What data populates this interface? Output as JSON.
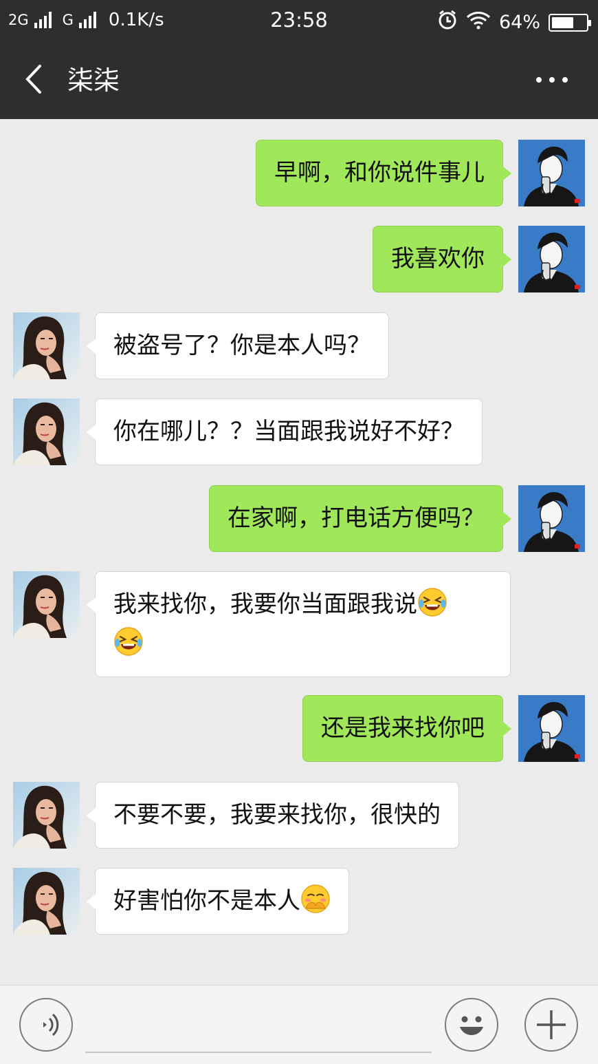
{
  "status_bar": {
    "network1": "2G",
    "network2": "G",
    "speed": "0.1K/s",
    "time": "23:58",
    "battery": "64%",
    "battery_level": 0.64,
    "icons": [
      "alarm-icon",
      "wifi-icon",
      "battery-icon"
    ]
  },
  "nav": {
    "title": "柒柒",
    "back_icon": "chevron-left-icon",
    "more_icon": "more-dots-icon"
  },
  "messages": [
    {
      "from": "me",
      "text": "早啊，和你说件事儿"
    },
    {
      "from": "me",
      "text": "我喜欢你"
    },
    {
      "from": "them",
      "text": "被盗号了？你是本人吗？"
    },
    {
      "from": "them",
      "text": "你在哪儿？？当面跟我说好不好？"
    },
    {
      "from": "me",
      "text": "在家啊，打电话方便吗？"
    },
    {
      "from": "them",
      "text": "我来找你，我要你当面跟我说",
      "emoji": [
        "laughing-tears-emoji",
        "laughing-tears-emoji"
      ]
    },
    {
      "from": "me",
      "text": "还是我来找你吧"
    },
    {
      "from": "them",
      "text": "不要不要，我要来找你，很快的"
    },
    {
      "from": "them",
      "text": "好害怕你不是本人",
      "emoji": [
        "shy-hands-emoji"
      ]
    }
  ],
  "input_bar": {
    "voice_icon": "voice-icon",
    "emoji_icon": "smiley-icon",
    "plus_icon": "plus-icon",
    "value": ""
  },
  "colors": {
    "nav_bg": "#2e2e2e",
    "chat_bg": "#ebebeb",
    "my_bubble": "#a0e75a",
    "their_bubble": "#ffffff"
  }
}
